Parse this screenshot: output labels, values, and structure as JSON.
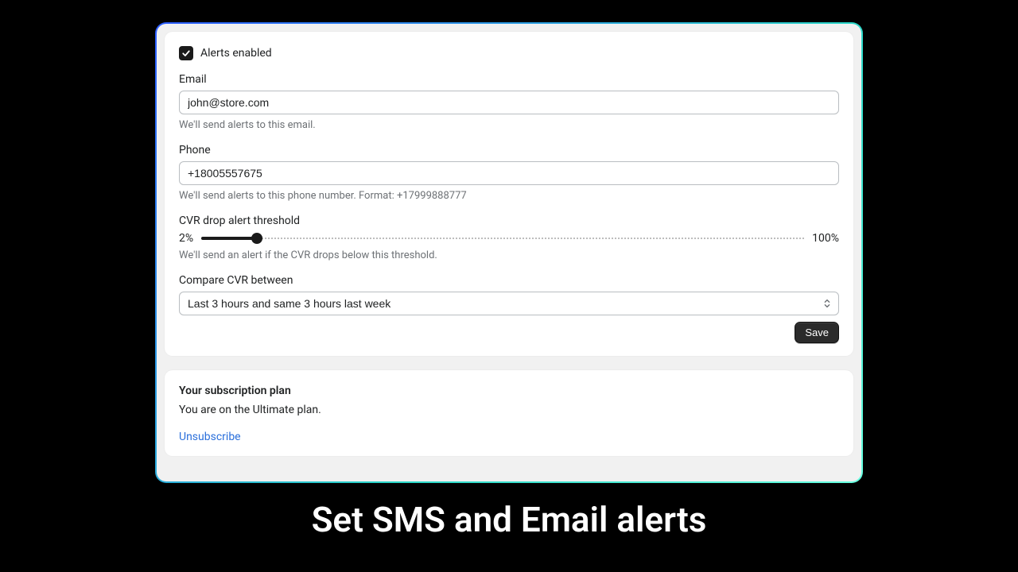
{
  "alerts": {
    "enabled_label": "Alerts enabled",
    "enabled_checked": true,
    "email_label": "Email",
    "email_value": "john@store.com",
    "email_help": "We'll send alerts to this email.",
    "phone_label": "Phone",
    "phone_value": "+18005557675",
    "phone_help": "We'll send alerts to this phone number. Format: +17999888777",
    "threshold_label": "CVR drop alert threshold",
    "threshold_min": "2%",
    "threshold_max": "100%",
    "threshold_help": "We'll send an alert if the CVR drops below this threshold.",
    "compare_label": "Compare CVR between",
    "compare_value": "Last 3 hours and same 3 hours last week",
    "save_label": "Save"
  },
  "subscription": {
    "title": "Your subscription plan",
    "text": "You are on the Ultimate plan.",
    "unsubscribe_label": "Unsubscribe"
  },
  "caption": "Set SMS and Email alerts"
}
